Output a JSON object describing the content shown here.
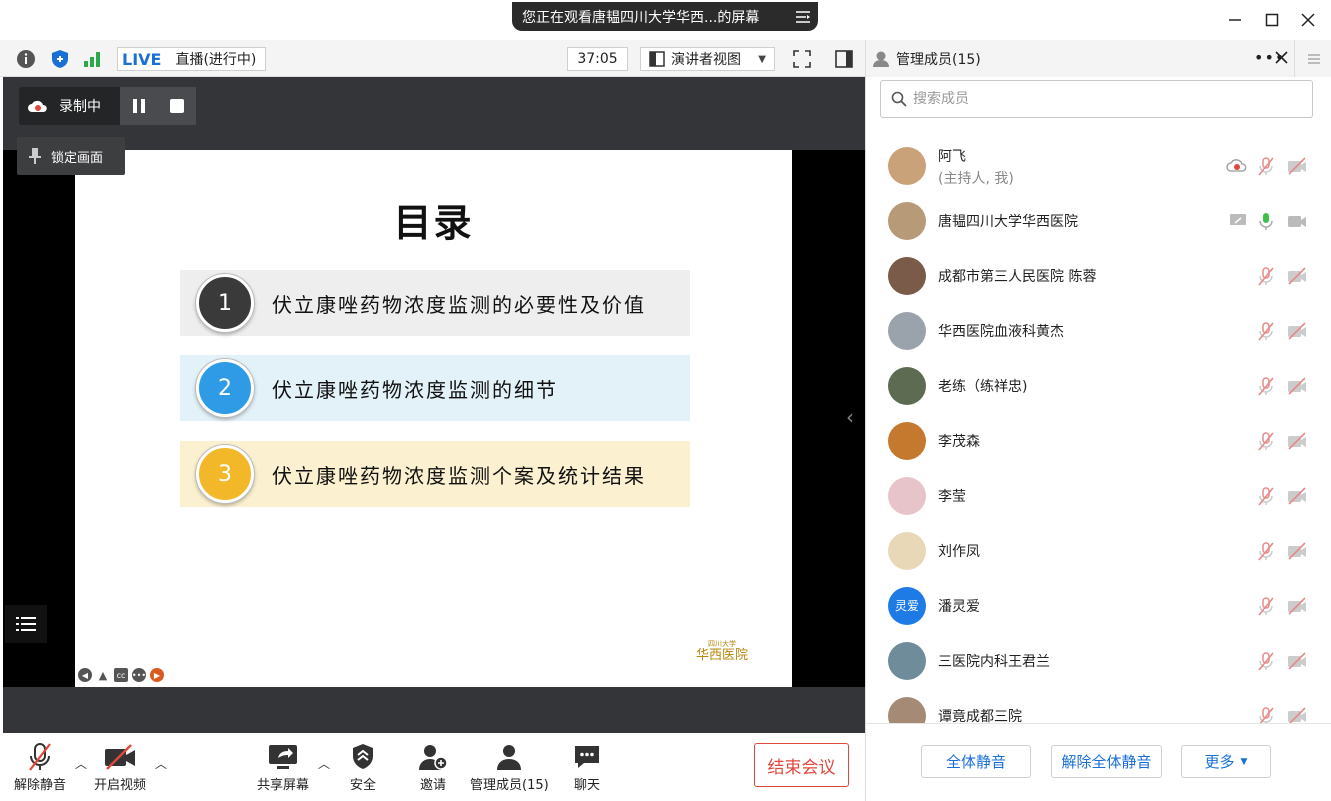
{
  "window": {
    "share_banner": "您正在观看唐韫四川大学华西...的屏幕"
  },
  "toolbar": {
    "live_badge": "LIVE",
    "live_status": "直播(进行中)",
    "timer": "37:05",
    "view_mode": "演讲者视图"
  },
  "recording": {
    "label": "录制中",
    "lock_view": "锁定画面"
  },
  "slide": {
    "title": "目录",
    "items": [
      {
        "num": "1",
        "text": "伏立康唑药物浓度监测的必要性及价值",
        "bg": "#eeeeee",
        "circle": "#3a3a3a"
      },
      {
        "num": "2",
        "text": "伏立康唑药物浓度监测的细节",
        "bg": "#e3f1f8",
        "circle": "#2f9be6"
      },
      {
        "num": "3",
        "text": "伏立康唑药物浓度监测个案及统计结果",
        "bg": "#fbf0cf",
        "circle": "#f2b82a"
      }
    ],
    "logo_text": "华西医院",
    "logo_sub": "四川大学"
  },
  "bottom": {
    "unmute": "解除静音",
    "start_video": "开启视频",
    "share_screen": "共享屏幕",
    "security": "安全",
    "invite": "邀请",
    "manage_members": "管理成员(15)",
    "chat": "聊天",
    "end_meeting": "结束会议"
  },
  "panel": {
    "title": "管理成员(15)",
    "search_placeholder": "搜索成员",
    "members": [
      {
        "name": "阿飞",
        "sub": "(主持人, 我)",
        "avatar": "#c9a27a"
      },
      {
        "name": "唐韫四川大学华西医院",
        "sub": "",
        "avatar": "#b79a78"
      },
      {
        "name": "成都市第三人民医院  陈蓉",
        "sub": "",
        "avatar": "#7a5a48"
      },
      {
        "name": "华西医院血液科黄杰",
        "sub": "",
        "avatar": "#9aa3ab"
      },
      {
        "name": "老练（练祥忠)",
        "sub": "",
        "avatar": "#5d6b52"
      },
      {
        "name": "李茂森",
        "sub": "",
        "avatar": "#c4792e"
      },
      {
        "name": "李莹",
        "sub": "",
        "avatar": "#e7c4c9"
      },
      {
        "name": "刘作凤",
        "sub": "",
        "avatar": "#e8d8b8"
      },
      {
        "name": "潘灵爱",
        "sub": "",
        "avatar": "#1e7be6",
        "initials": "灵爱"
      },
      {
        "name": "三医院内科王君兰",
        "sub": "",
        "avatar": "#6f8c9a"
      },
      {
        "name": "谭竟成都三院",
        "sub": "",
        "avatar": "#a58a76"
      }
    ],
    "mute_all": "全体静音",
    "unmute_all": "解除全体静音",
    "more": "更多"
  },
  "colors": {
    "accent": "#1a6fd6",
    "danger": "#e0483e",
    "muted_icon": "#e68a8a"
  }
}
